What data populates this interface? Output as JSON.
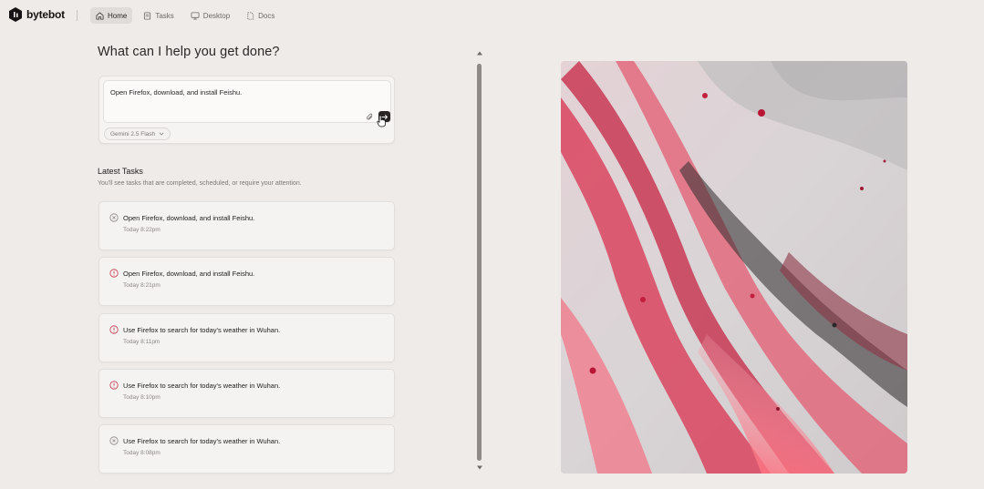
{
  "brand": {
    "name": "bytebot"
  },
  "nav": {
    "items": [
      {
        "label": "Home",
        "icon": "home-icon",
        "active": true
      },
      {
        "label": "Tasks",
        "icon": "tasks-icon",
        "active": false
      },
      {
        "label": "Desktop",
        "icon": "desktop-icon",
        "active": false
      },
      {
        "label": "Docs",
        "icon": "docs-icon",
        "active": false
      }
    ]
  },
  "main": {
    "heading": "What can I help you get done?",
    "input": {
      "value": "Open Firefox, download, and install Feishu."
    },
    "model": {
      "selected": "Gemini 2.5 Flash"
    }
  },
  "latest": {
    "title": "Latest Tasks",
    "subtitle": "You'll see tasks that are completed, scheduled, or require your attention.",
    "tasks": [
      {
        "title": "Open Firefox, download, and install Feishu.",
        "time": "Today 8:22pm",
        "status": "cancelled",
        "status_icon": "x-circle-icon"
      },
      {
        "title": "Open Firefox, download, and install Feishu.",
        "time": "Today 8:21pm",
        "status": "failed",
        "status_icon": "alert-circle-icon"
      },
      {
        "title": "Use Firefox to search for today's weather in Wuhan.",
        "time": "Today 8:11pm",
        "status": "failed",
        "status_icon": "alert-circle-icon"
      },
      {
        "title": "Use Firefox to search for today's weather in Wuhan.",
        "time": "Today 8:10pm",
        "status": "failed",
        "status_icon": "alert-circle-icon"
      },
      {
        "title": "Use Firefox to search for today's weather in Wuhan.",
        "time": "Today 8:08pm",
        "status": "cancelled",
        "status_icon": "x-circle-icon"
      }
    ]
  },
  "colors": {
    "background": "#eeebe9",
    "failed": "#c4344b",
    "cancelled": "#8a8582",
    "send_button": "#2a2525"
  }
}
